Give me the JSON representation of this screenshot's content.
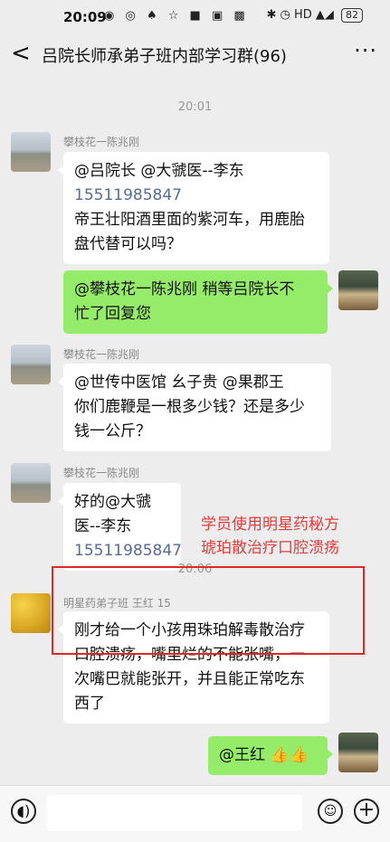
{
  "status": {
    "time": "20:09",
    "left_icons": "◉ ◎ ♠ ☆ ■ ▣ ▩",
    "right_icons": "✱ ◷ HD ▲◢",
    "battery": "82"
  },
  "header": {
    "back": "<",
    "title": "吕院长师承弟子班内部学习群(96)",
    "more": "···"
  },
  "timestamps": [
    "20:01",
    "20:06"
  ],
  "messages": [
    {
      "sender": "攀枝花一陈兆刚",
      "lines": [
        "@吕院长 @大虢医--李东",
        "15511985847",
        "帝王壮阳酒里面的紫河车，用鹿胎",
        "盘代替可以吗？"
      ]
    },
    {
      "lines": [
        "@攀枝花一陈兆刚  稍等吕院长不",
        "忙了回复您"
      ]
    },
    {
      "sender": "攀枝花一陈兆刚",
      "lines": [
        " @世传中医馆  幺子贵  @果郡王",
        "你们鹿鞭是一根多少钱？还是多少",
        "钱一公斤？"
      ]
    },
    {
      "sender": "攀枝花一陈兆刚",
      "lines": [
        "好的@大虢医--李东",
        "15511985847"
      ]
    },
    {
      "sender": "明星药弟子班 王红 15",
      "lines": [
        "刚才给一个小孩用珠珀解毒散治疗",
        "口腔溃疡，嘴里烂的不能张嘴，一",
        "次嘴巴就能张开，并且能正常吃东",
        "西了"
      ]
    },
    {
      "lines": [
        "@王红 👍👍"
      ]
    }
  ],
  "annotation": [
    "学员使用明星药秘方",
    "琥珀散治疗口腔溃疡"
  ],
  "bottom": {
    "voice": "◖)",
    "emoji": "☺",
    "plus": "+"
  }
}
